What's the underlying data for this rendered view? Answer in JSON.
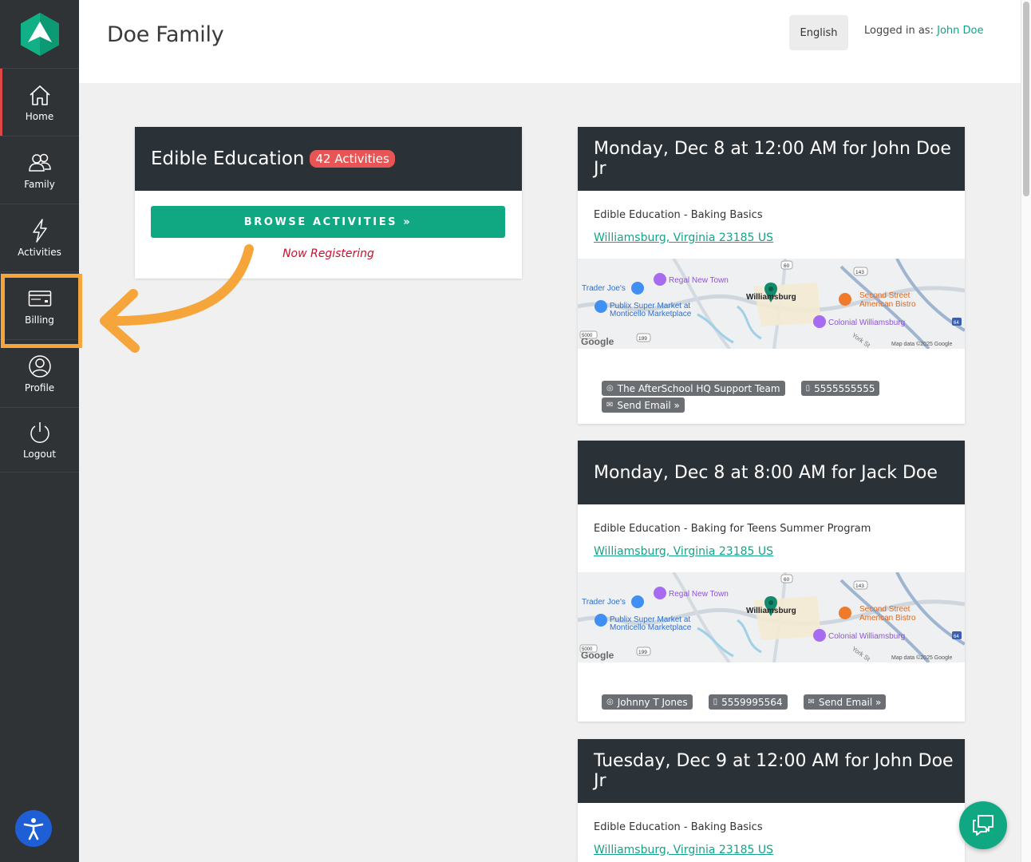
{
  "sidebar": {
    "items": [
      {
        "label": "Home",
        "icon": "home-icon"
      },
      {
        "label": "Family",
        "icon": "family-icon"
      },
      {
        "label": "Activities",
        "icon": "lightning-icon"
      },
      {
        "label": "Billing",
        "icon": "credit-card-icon"
      },
      {
        "label": "Profile",
        "icon": "user-icon"
      },
      {
        "label": "Logout",
        "icon": "power-icon"
      }
    ]
  },
  "header": {
    "title": "Doe Family",
    "language": "English",
    "logged_in_prefix": "Logged in as:",
    "user": "John Doe"
  },
  "org": {
    "name": "Edible Education",
    "badge": "42 Activities",
    "browse_label": "BROWSE ACTIVITIES »",
    "status": "Now Registering"
  },
  "events": [
    {
      "title": "Monday, Dec 8 at 12:00 AM for John Doe Jr",
      "activity": "Edible Education - Baking Basics",
      "address": "Williamsburg, Virginia 23185 US",
      "contacts": [
        "The AfterSchool HQ Support Team",
        "5555555555",
        "Send Email »"
      ]
    },
    {
      "title": "Monday, Dec 8 at 8:00 AM for Jack Doe",
      "activity": "Edible Education - Baking for Teens Summer Program",
      "address": "Williamsburg, Virginia 23185 US",
      "contacts": [
        "Johnny T Jones",
        "5559995564",
        "Send Email »"
      ]
    },
    {
      "title": "Tuesday, Dec 9 at 12:00 AM for John Doe Jr",
      "activity": "Edible Education - Baking Basics",
      "address": "Williamsburg, Virginia 23185 US"
    }
  ],
  "map": {
    "labels": [
      "Trader Joe's",
      "Regal New Town",
      "Williamsburg",
      "Second Street",
      "American Bistro",
      "Publix Super Market at",
      "Monticello Marketplace",
      "Colonial Williamsburg",
      "Google",
      "Map data ©2025 Google",
      "York St",
      "60",
      "143",
      "199",
      "5000",
      "64"
    ]
  },
  "colors": {
    "accent": "#0fa882",
    "sidebar": "#303336",
    "highlight": "#f6a53b",
    "badge": "#e95454"
  }
}
